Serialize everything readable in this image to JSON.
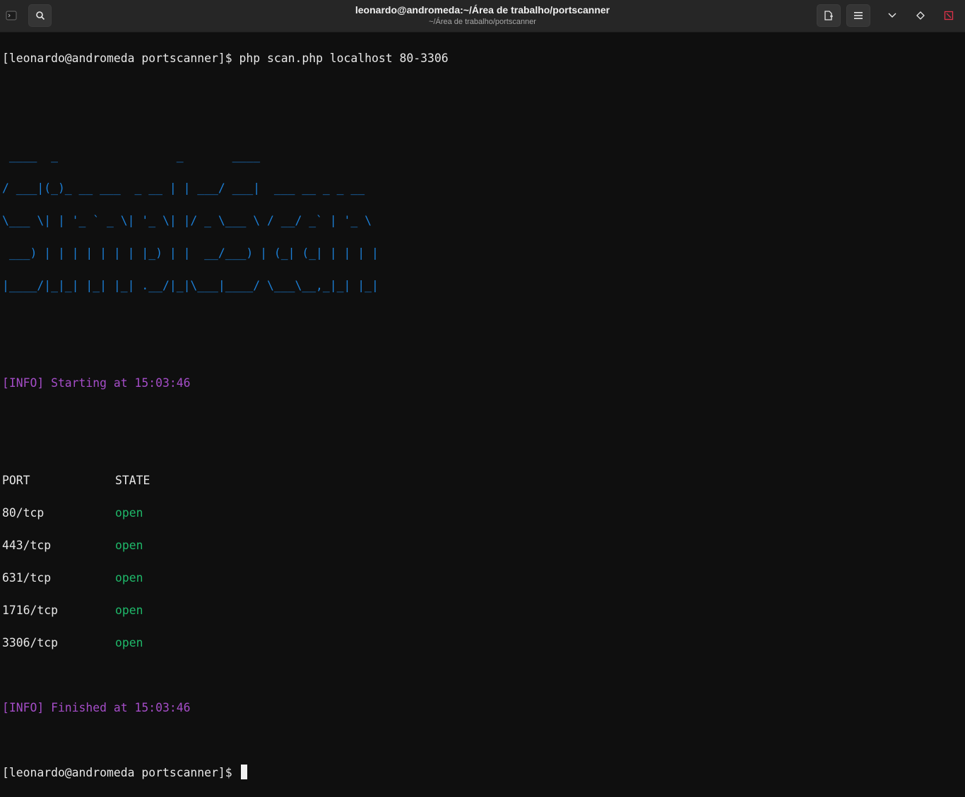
{
  "window": {
    "title": "leonardo@andromeda:~/Área de trabalho/portscanner",
    "subtitle": "~/Área de trabalho/portscanner",
    "icons": {
      "app": "terminal-app-icon",
      "search": "search-icon",
      "new_tab": "new-tab-icon",
      "menu": "hamburger-menu-icon",
      "minimize": "chevron-down-icon",
      "maximize": "diamond-icon",
      "close": "close-icon"
    },
    "close_color": "#e0324a"
  },
  "terminal": {
    "prompt": "[leonardo@andromeda portscanner]$ ",
    "command": "php scan.php localhost 80-3306",
    "banner": [
      " ____  _                 _       ____",
      "/ ___|(_)_ __ ___  _ __ | | ___/ ___|  ___ __ _ _ __",
      "\\___ \\| | '_ ` _ \\| '_ \\| |/ _ \\___ \\ / __/ _` | '_ \\",
      " ___) | | | | | | | |_) | |  __/___) | (_| (_| | | | |",
      "|____/|_|_| |_| |_| .__/|_|\\___|____/ \\___\\__,_|_| |_|"
    ],
    "banner_color": "#1c7fd6",
    "info_color": "#a54dc8",
    "open_color": "#1fb96a",
    "start_line": "[INFO] Starting at 15:03:46",
    "table_header": {
      "port": "PORT",
      "state": "STATE"
    },
    "rows": [
      {
        "port": "80/tcp",
        "state": "open"
      },
      {
        "port": "443/tcp",
        "state": "open"
      },
      {
        "port": "631/tcp",
        "state": "open"
      },
      {
        "port": "1716/tcp",
        "state": "open"
      },
      {
        "port": "3306/tcp",
        "state": "open"
      }
    ],
    "end_line": "[INFO] Finished at 15:03:46",
    "final_prompt": "[leonardo@andromeda portscanner]$ "
  }
}
